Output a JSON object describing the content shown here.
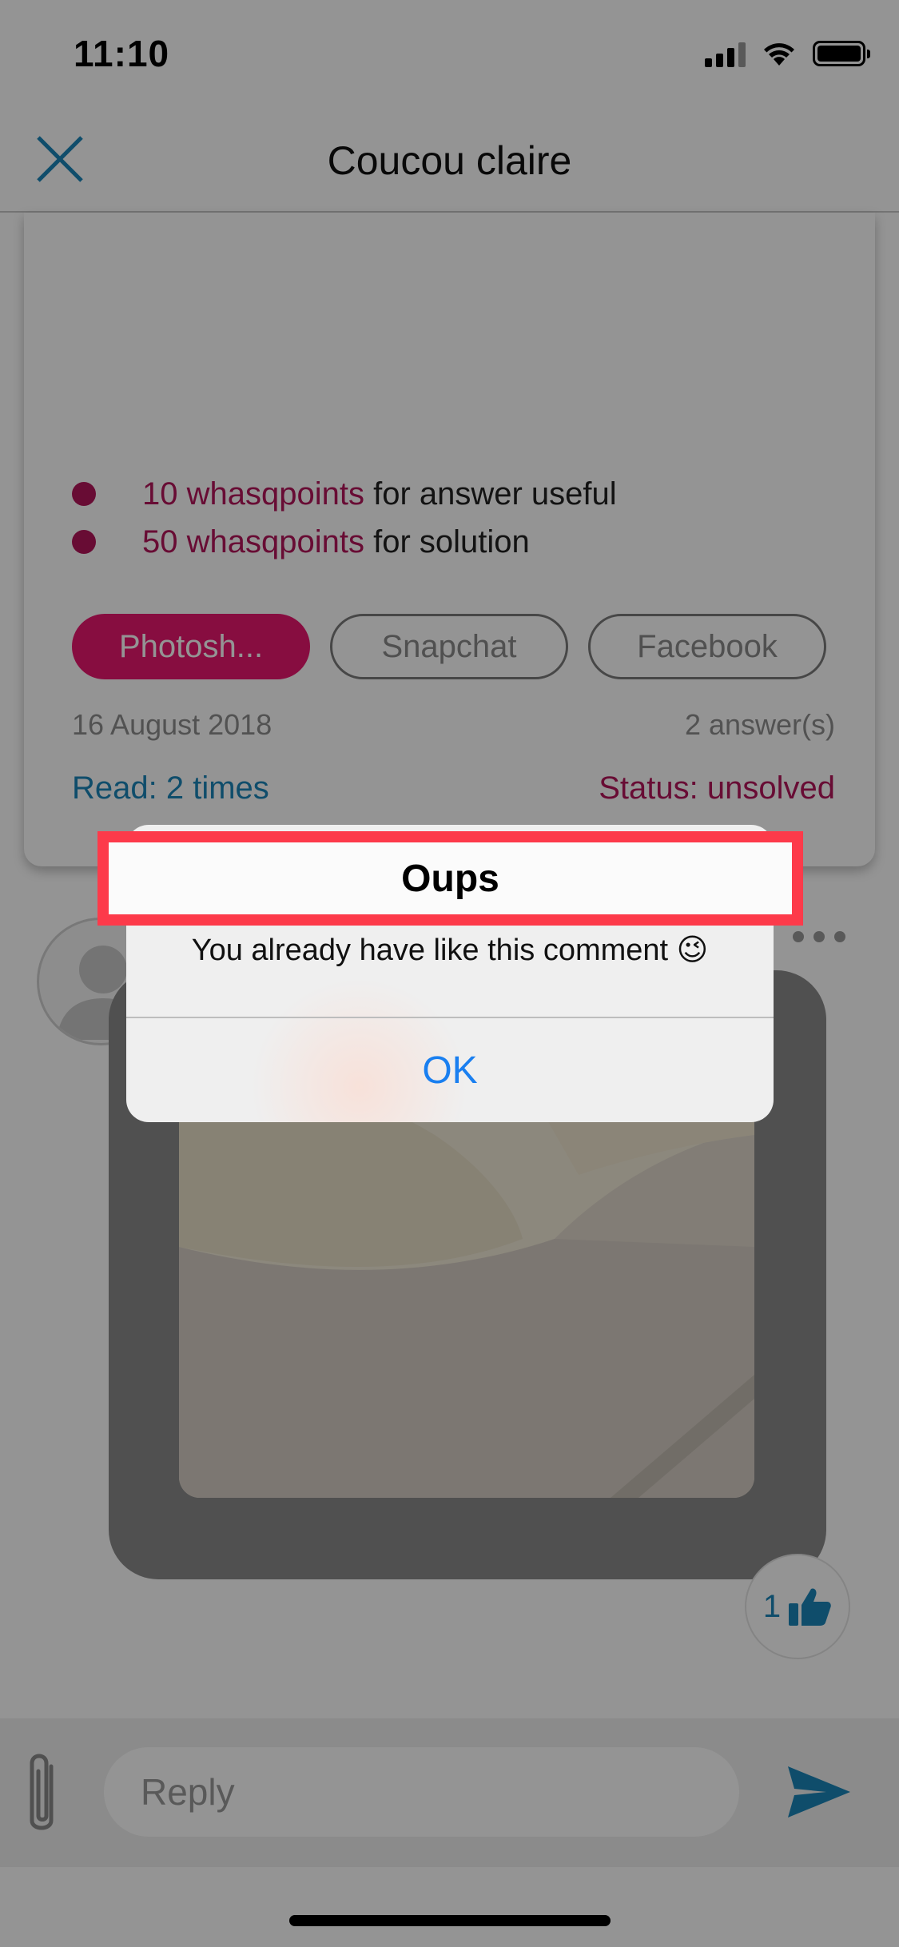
{
  "status_bar": {
    "time": "11:10"
  },
  "nav": {
    "title": "Coucou claire"
  },
  "question": {
    "points": [
      {
        "amount": "10 whasqpoints",
        "suffix": " for answer useful"
      },
      {
        "amount": "50 whasqpoints",
        "suffix": " for solution"
      }
    ],
    "tags": [
      "Photosh...",
      "Snapchat",
      "Facebook"
    ],
    "date": "16 August 2018",
    "answers": "2 answer(s)",
    "read": "Read: 2 times",
    "status": "Status: unsolved"
  },
  "answer": {
    "like_count": "1"
  },
  "reply": {
    "placeholder": "Reply"
  },
  "alert": {
    "title": "Oups",
    "message": "You already have like this comment 😉",
    "ok_label": "OK"
  },
  "colors": {
    "accent_pink": "#e8176f",
    "points_magenta": "#b4155b",
    "link_blue": "#1b85b8",
    "ios_blue": "#1a7ff0",
    "highlight_red": "#fd3a4a"
  }
}
